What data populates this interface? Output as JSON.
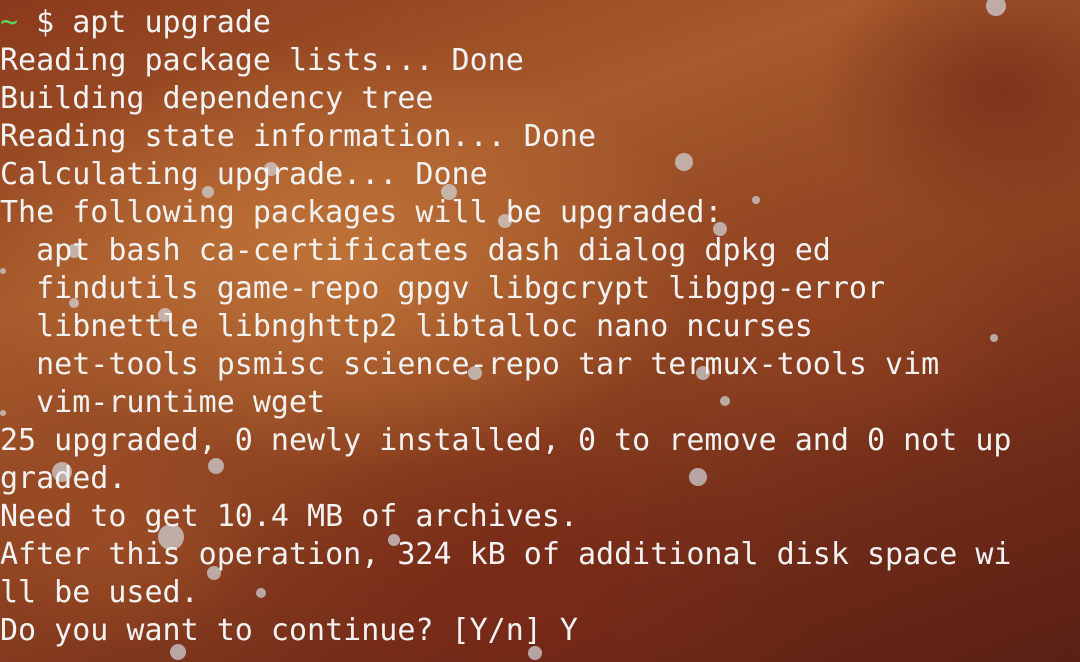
{
  "prompt": {
    "tilde": "~",
    "symbol": " $ ",
    "command": "apt upgrade"
  },
  "output": [
    "Reading package lists... Done",
    "Building dependency tree",
    "Reading state information... Done",
    "Calculating upgrade... Done",
    "The following packages will be upgraded:",
    "  apt bash ca-certificates dash dialog dpkg ed",
    "  findutils game-repo gpgv libgcrypt libgpg-error",
    "  libnettle libnghttp2 libtalloc nano ncurses",
    "  net-tools psmisc science-repo tar termux-tools vim",
    "  vim-runtime wget",
    "25 upgraded, 0 newly installed, 0 to remove and 0 not up",
    "graded.",
    "Need to get 10.4 MB of archives.",
    "After this operation, 324 kB of additional disk space wi",
    "ll be used.",
    "Do you want to continue? [Y/n] Y"
  ],
  "colors": {
    "prompt_tilde": "#5fd35f",
    "text": "#f2f2f2"
  }
}
